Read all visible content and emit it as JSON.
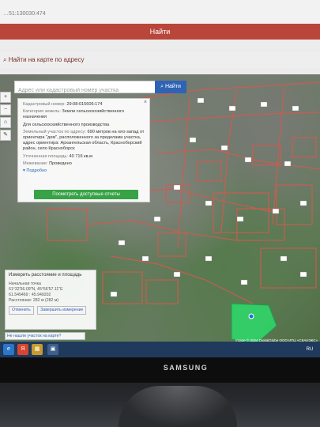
{
  "top": {
    "url_text": "…51:130030:474",
    "find_label": "Найти"
  },
  "section": {
    "title": "Найти на карте по адресу"
  },
  "map_search": {
    "placeholder": "Адрес или кадастровый номер участка",
    "button": "Найти"
  },
  "tools": [
    "+",
    "−",
    "⌂",
    "✎"
  ],
  "parcel_info": {
    "cadastral_label": "Кадастровый номер:",
    "cadastral_value": "29:08:015606:174",
    "category_label": "Категория земель:",
    "category_value": "Земли сельскохозяйственного назначения",
    "usage_value": "Для сельскохозяйственного производства",
    "address_label": "Земельный участок по адресу:",
    "address_value": "690 метров на юго-запад от ориентира \"дом\", расположенного за пределами участка, адрес ориентира: Архангельская область, Красноборский район, село Красноборск",
    "area_label": "Уточненная площадь:",
    "area_value": "40 716 кв.м",
    "surveying_label": "Межевание:",
    "surveying_value": "Проведено",
    "more_link": "Подробно",
    "report_button": "Посмотреть доступные отчеты"
  },
  "measure": {
    "title": "Измерить расстояние и площадь",
    "start_label": "Начальная точка",
    "coords": "61°32'56.09\"N, 45°56'57.11\"E",
    "decimal": "61.549469 : 45.949202",
    "distance": "Расстояние: 282 м (282 м)",
    "cancel": "Отменить",
    "finish": "Завершить измерение"
  },
  "not_found_link": "Не нашли участок на карте?",
  "credits": "Image © 2024 DigitalGlobe     ООО ИТЦ «СКАНЭКС»",
  "taskbar": {
    "items": [
      "e",
      "Я",
      "▦",
      "▣"
    ],
    "lang": "RU"
  },
  "monitor_brand": "SAMSUNG",
  "colors": {
    "accent_red": "#b9463b",
    "search_blue": "#2f63b5",
    "report_green": "#37a346",
    "parcel_outline": "#d25a4e",
    "selected_parcel": "#2fd66a"
  }
}
